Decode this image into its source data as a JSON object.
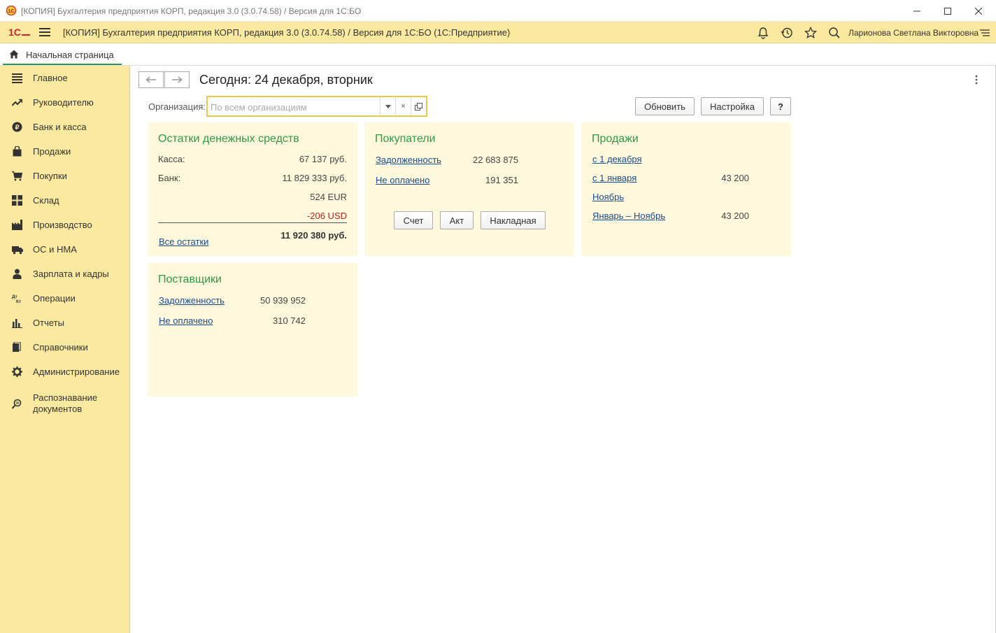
{
  "window": {
    "title": "[КОПИЯ] Бухгалтерия предприятия КОРП, редакция 3.0 (3.0.74.58) /  Версия для 1С:БО",
    "controls": [
      "minimize-icon",
      "maximize-icon",
      "close-icon"
    ]
  },
  "appbar": {
    "title": "[КОПИЯ] Бухгалтерия предприятия КОРП, редакция 3.0 (3.0.74.58) /  Версия для 1С:БО  (1С:Предприятие)",
    "user": "Ларионова Светлана Викторовна",
    "icons": [
      "bell-icon",
      "history-icon",
      "star-icon",
      "search-icon",
      "settings-menu-icon"
    ]
  },
  "tabs": [
    {
      "label": "Начальная страница",
      "icon": "home-icon",
      "active": true
    }
  ],
  "sidebar": {
    "items": [
      {
        "label": "Главное",
        "icon": "list-icon"
      },
      {
        "label": "Руководителю",
        "icon": "trend-icon"
      },
      {
        "label": "Банк и касса",
        "icon": "coin-icon"
      },
      {
        "label": "Продажи",
        "icon": "bag-icon"
      },
      {
        "label": "Покупки",
        "icon": "cart-icon"
      },
      {
        "label": "Склад",
        "icon": "grid-icon"
      },
      {
        "label": "Производство",
        "icon": "factory-icon"
      },
      {
        "label": "ОС и НМА",
        "icon": "truck-icon"
      },
      {
        "label": "Зарплата и кадры",
        "icon": "person-icon"
      },
      {
        "label": "Операции",
        "icon": "dt-kt-icon"
      },
      {
        "label": "Отчеты",
        "icon": "bar-chart-icon"
      },
      {
        "label": "Справочники",
        "icon": "books-icon"
      },
      {
        "label": "Администрирование",
        "icon": "gear-icon"
      },
      {
        "label": "Распознавание",
        "label2": "документов",
        "icon": "scan-icon"
      }
    ]
  },
  "header": {
    "title": "Сегодня: 24 декабря, вторник",
    "org_label": "Организация:",
    "org_placeholder": "По всем организациям",
    "clear_glyph": "×",
    "refresh_label": "Обновить",
    "settings_label": "Настройка",
    "help_label": "?"
  },
  "cash": {
    "title": "Остатки денежных средств",
    "kassa_label": "Касса:",
    "kassa_value": "67 137 руб.",
    "bank_label": "Банк:",
    "bank_rub": "11 829 333 руб.",
    "bank_eur": "524 EUR",
    "bank_usd": "-206 USD",
    "all_link": "Все остатки",
    "total": "11 920 380 руб."
  },
  "customers": {
    "title": "Покупатели",
    "debt_link": "Задолженность",
    "debt_value": "22 683 875",
    "unpaid_link": "Не оплачено",
    "unpaid_value": "191 351",
    "btn_invoice": "Счет",
    "btn_act": "Акт",
    "btn_waybill": "Накладная"
  },
  "sales": {
    "title": "Продажи",
    "rows": [
      {
        "link": "с 1 декабря",
        "value": ""
      },
      {
        "link": "с 1 января",
        "value": "43 200"
      },
      {
        "link": "Ноябрь",
        "value": ""
      },
      {
        "link": "Январь – Ноябрь",
        "value": "43 200"
      }
    ]
  },
  "suppliers": {
    "title": "Поставщики",
    "debt_link": "Задолженность",
    "debt_value": "50 939 952",
    "unpaid_link": "Не оплачено",
    "unpaid_value": "310 742"
  },
  "colors": {
    "accent_yellow": "#fbe9a0",
    "panel_bg": "#fef8dc",
    "title_green": "#2e9a47",
    "link_blue": "#1a4b8c",
    "negative_red": "#b22222"
  }
}
